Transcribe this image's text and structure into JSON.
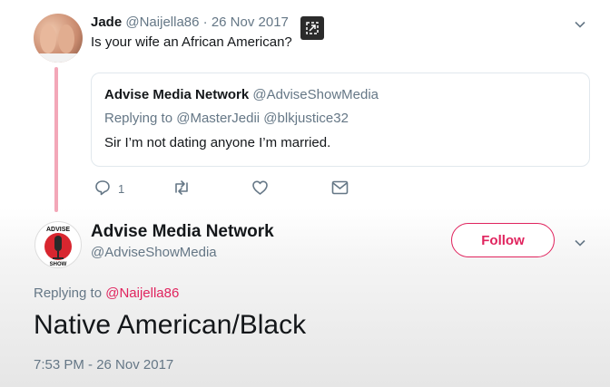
{
  "reply_tweet": {
    "name": "Jade",
    "handle": "@Naijella86",
    "separator": "·",
    "date": "26 Nov 2017",
    "text": "Is your wife an African American?"
  },
  "quoted_tweet": {
    "name": "Advise Media Network",
    "handle": "@AdviseShowMedia",
    "replying_prefix": "Replying to",
    "replying_handles": "@MasterJedii @blkjustice32",
    "text": "Sir I’m not dating anyone I’m married."
  },
  "actions": {
    "reply_icon": "reply-icon",
    "reply_count": "1",
    "retweet_icon": "retweet-icon",
    "like_icon": "heart-icon",
    "dm_icon": "envelope-icon"
  },
  "main_tweet": {
    "avatar_text_top": "ADVISE",
    "avatar_text_bottom": "SHOW",
    "name": "Advise Media Network",
    "handle": "@AdviseShowMedia",
    "follow_label": "Follow",
    "replying_prefix": "Replying to",
    "replying_handle": "@Naijella86",
    "text": "Native American/Black",
    "timestamp": "7:53 PM - 26 Nov 2017"
  },
  "colors": {
    "accent": "#e0245e",
    "link": "#e0245e",
    "thread_line": "#f3a7b8",
    "muted": "#657786"
  }
}
